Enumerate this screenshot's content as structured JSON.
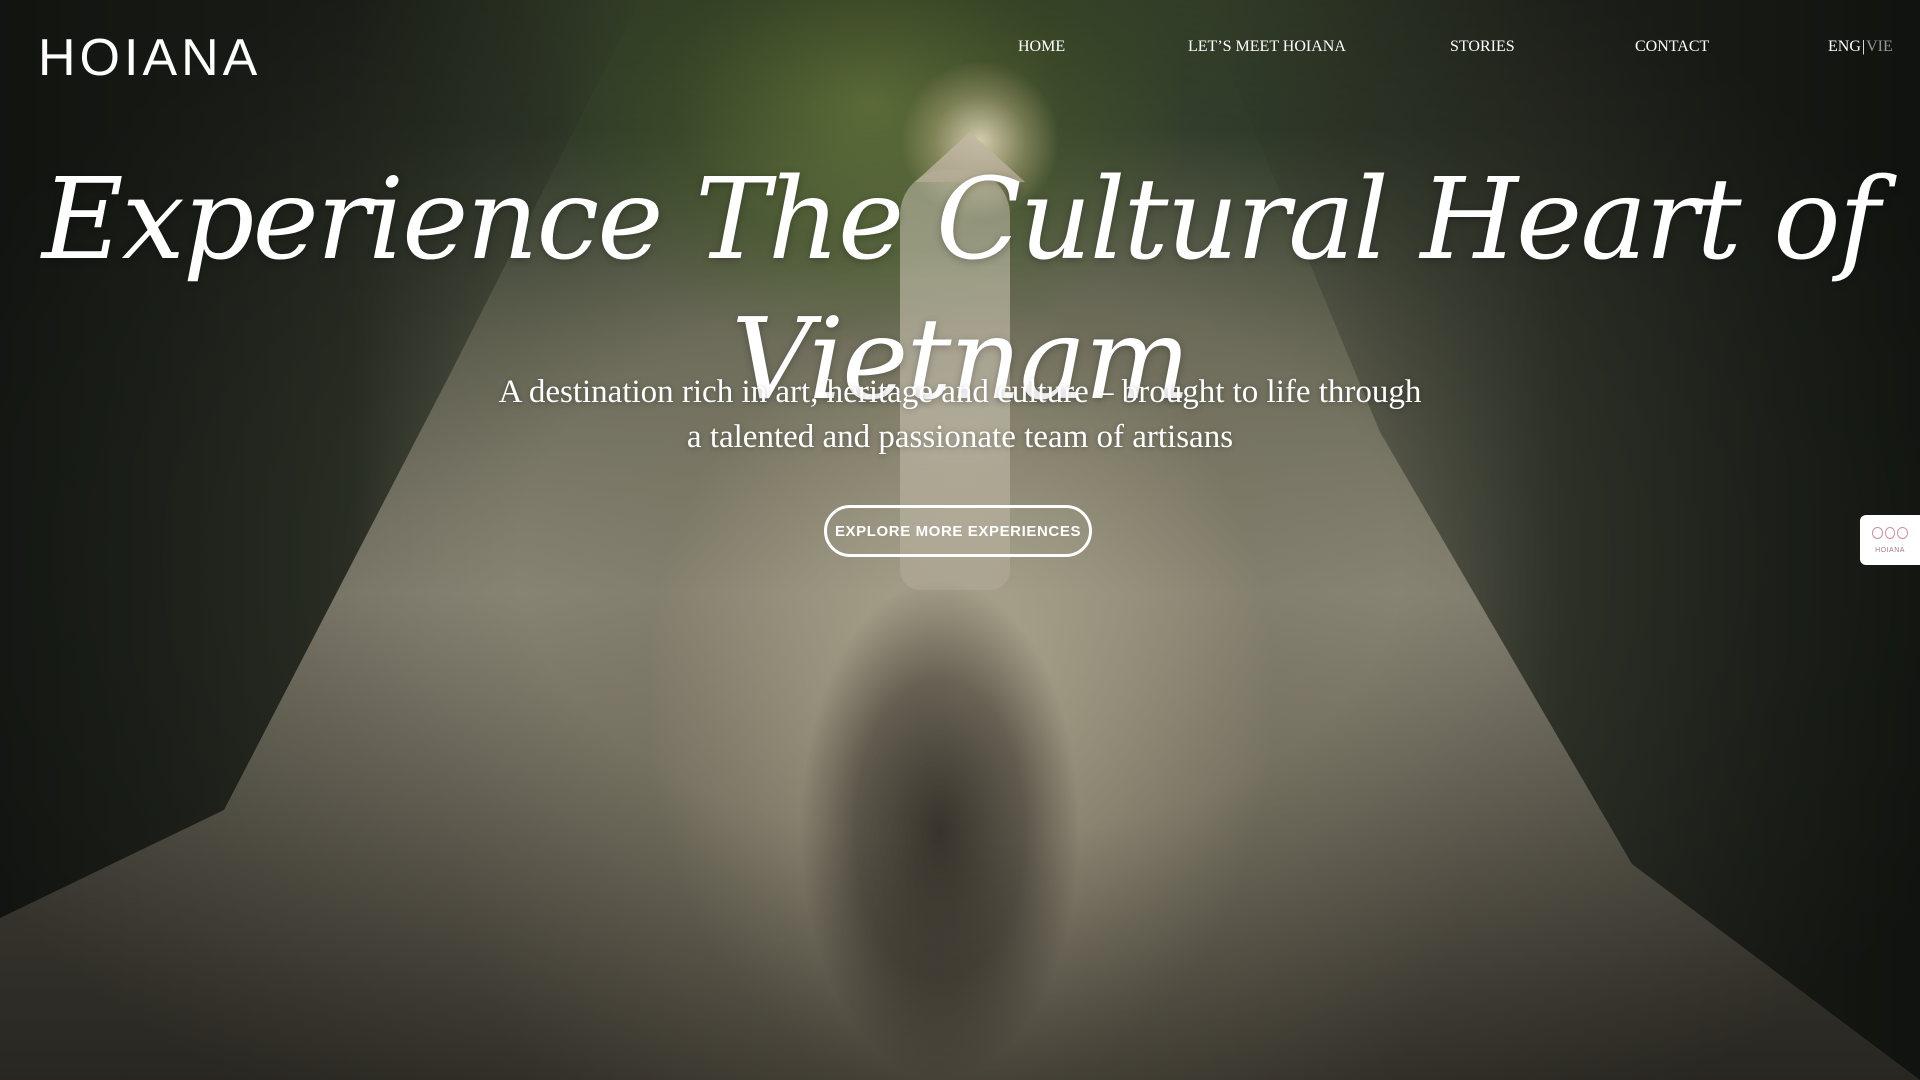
{
  "brand": {
    "logo_text": "HOIANA"
  },
  "nav": {
    "items": [
      {
        "label": "HOME"
      },
      {
        "label": "LET’S MEET HOIANA"
      },
      {
        "label": "STORIES"
      },
      {
        "label": "CONTACT"
      }
    ],
    "language": {
      "active": "ENG",
      "separator": "|",
      "inactive": "VIE"
    }
  },
  "hero": {
    "title": "Experience The Cultural Heart of Vietnam",
    "subtitle_line1": "A destination rich in art, heritage and culture – brought to life through",
    "subtitle_line2": "a talented and passionate team of artisans",
    "cta_label": "EXPLORE MORE EXPERIENCES"
  },
  "side_widget": {
    "text": "HOIANA",
    "icon": "flower-logo-icon",
    "accent_color": "#c98fa2"
  }
}
